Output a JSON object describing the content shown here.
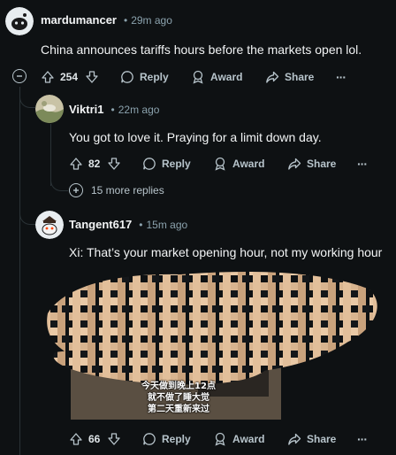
{
  "comments": [
    {
      "username": "mardumancer",
      "time": "29m ago",
      "body": "China announces tariffs hours before the markets open lol.",
      "votes": "254",
      "reply": "Reply",
      "award": "Award",
      "share": "Share",
      "more": "···"
    },
    {
      "username": "Viktri1",
      "time": "22m ago",
      "body": "You got to love it. Praying for a limit down day.",
      "votes": "82",
      "reply": "Reply",
      "award": "Award",
      "share": "Share",
      "more": "···",
      "more_replies": "15 more replies"
    },
    {
      "username": "Tangent617",
      "time": "15m ago",
      "body": "Xi: That’s your market opening hour, not my working hour",
      "votes": "66",
      "reply": "Reply",
      "award": "Award",
      "share": "Share",
      "more": "···",
      "image_caption": [
        "今天做到晚上12点",
        "就不做了睡大觉",
        "第二天重新来过"
      ]
    }
  ],
  "separator": "•",
  "colors": {
    "background": "#0e1113",
    "meta": "#8ba2ad",
    "action": "#b7c4cb"
  }
}
